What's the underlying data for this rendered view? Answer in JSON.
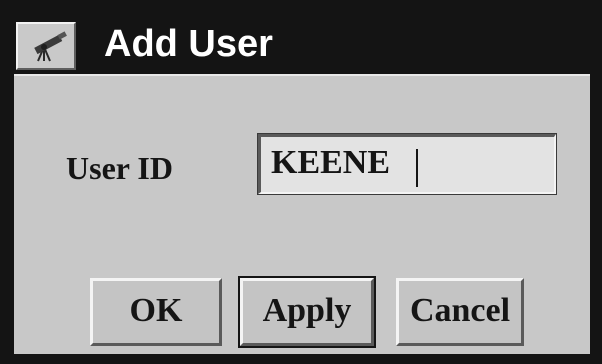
{
  "window": {
    "title": "Add User",
    "icon": "telescope-icon"
  },
  "form": {
    "user_id_label": "User ID",
    "user_id_value": "KEENE"
  },
  "buttons": {
    "ok_label": "OK",
    "apply_label": "Apply",
    "cancel_label": "Cancel"
  },
  "colors": {
    "titlebar": "#141414",
    "panel": "#c8c8c8",
    "input_bg": "#e3e3e3"
  }
}
